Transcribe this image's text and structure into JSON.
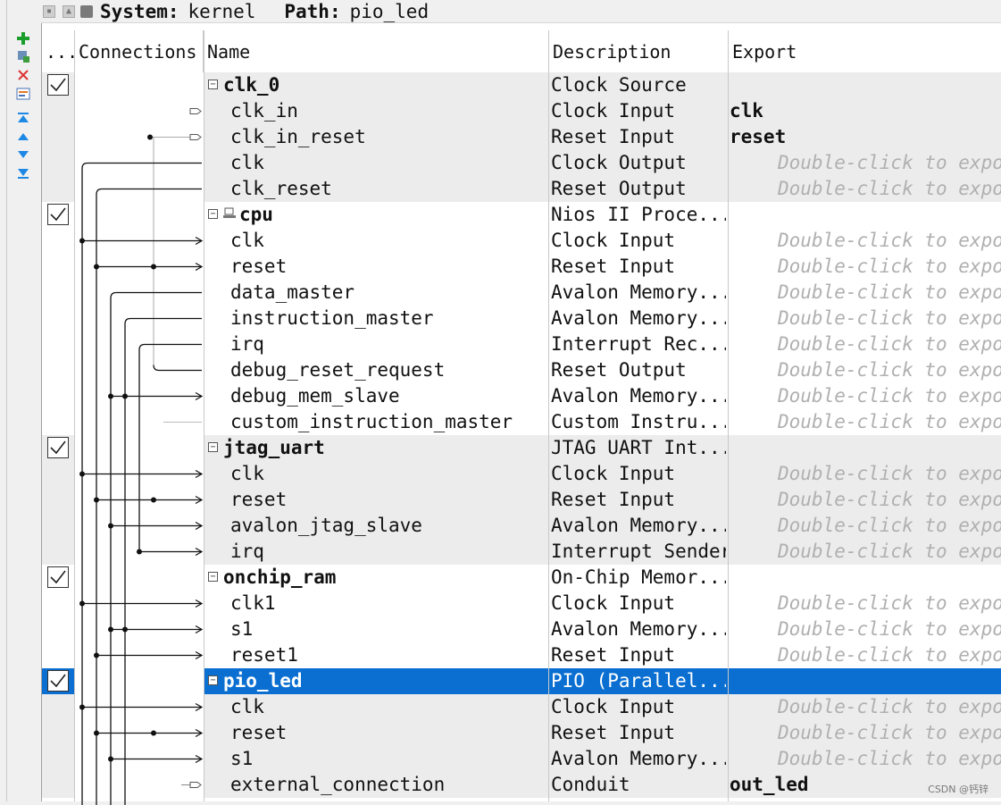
{
  "toolbar": {
    "add_icon": "plus-icon",
    "buttons": [
      "add-icon",
      "import-icon",
      "remove-icon",
      "edit-icon",
      "move-top-icon",
      "move-up-icon",
      "move-down-icon",
      "move-bottom-icon"
    ]
  },
  "topbar": {
    "system_label": "System:",
    "system_value": "kernel",
    "path_label": "Path:",
    "path_value": "pio_led"
  },
  "columns": {
    "use": "...",
    "connections": "Connections",
    "name": "Name",
    "description": "Description",
    "export": "Export"
  },
  "rows": [
    {
      "kind": "component",
      "name": "clk_0",
      "description": "Clock Source",
      "export": "",
      "checked": true
    },
    {
      "kind": "port",
      "name": "clk_in",
      "description": "Clock Input",
      "export": "clk",
      "export_style": "bold"
    },
    {
      "kind": "port",
      "name": "clk_in_reset",
      "description": "Reset Input",
      "export": "reset",
      "export_style": "bold"
    },
    {
      "kind": "port",
      "name": "clk",
      "description": "Clock Output",
      "export": "Double-click to expo",
      "export_style": "hint"
    },
    {
      "kind": "port",
      "name": "clk_reset",
      "description": "Reset Output",
      "export": "Double-click to expo",
      "export_style": "hint"
    },
    {
      "kind": "component",
      "name": "cpu",
      "description": "Nios II Proce...",
      "export": "",
      "checked": true,
      "has_icon": true
    },
    {
      "kind": "port",
      "name": "clk",
      "description": "Clock Input",
      "export": "Double-click to expo",
      "export_style": "hint"
    },
    {
      "kind": "port",
      "name": "reset",
      "description": "Reset Input",
      "export": "Double-click to expo",
      "export_style": "hint"
    },
    {
      "kind": "port",
      "name": "data_master",
      "description": "Avalon Memory...",
      "export": "Double-click to expo",
      "export_style": "hint"
    },
    {
      "kind": "port",
      "name": "instruction_master",
      "description": "Avalon Memory...",
      "export": "Double-click to expo",
      "export_style": "hint"
    },
    {
      "kind": "port",
      "name": "irq",
      "description": "Interrupt Rec...",
      "export": "Double-click to expo",
      "export_style": "hint"
    },
    {
      "kind": "port",
      "name": "debug_reset_request",
      "description": "Reset Output",
      "export": "Double-click to expo",
      "export_style": "hint"
    },
    {
      "kind": "port",
      "name": "debug_mem_slave",
      "description": "Avalon Memory...",
      "export": "Double-click to expo",
      "export_style": "hint"
    },
    {
      "kind": "port",
      "name": "custom_instruction_master",
      "description": "Custom Instru...",
      "export": "Double-click to expo",
      "export_style": "hint"
    },
    {
      "kind": "component",
      "name": "jtag_uart",
      "description": "JTAG UART Int...",
      "export": "",
      "checked": true
    },
    {
      "kind": "port",
      "name": "clk",
      "description": "Clock Input",
      "export": "Double-click to expo",
      "export_style": "hint"
    },
    {
      "kind": "port",
      "name": "reset",
      "description": "Reset Input",
      "export": "Double-click to expo",
      "export_style": "hint"
    },
    {
      "kind": "port",
      "name": "avalon_jtag_slave",
      "description": "Avalon Memory...",
      "export": "Double-click to expo",
      "export_style": "hint"
    },
    {
      "kind": "port",
      "name": "irq",
      "description": "Interrupt Sender",
      "export": "Double-click to expo",
      "export_style": "hint"
    },
    {
      "kind": "component",
      "name": "onchip_ram",
      "description": "On-Chip Memor...",
      "export": "",
      "checked": true
    },
    {
      "kind": "port",
      "name": "clk1",
      "description": "Clock Input",
      "export": "Double-click to expo",
      "export_style": "hint"
    },
    {
      "kind": "port",
      "name": "s1",
      "description": "Avalon Memory...",
      "export": "Double-click to expo",
      "export_style": "hint"
    },
    {
      "kind": "port",
      "name": "reset1",
      "description": "Reset Input",
      "export": "Double-click to expo",
      "export_style": "hint"
    },
    {
      "kind": "component",
      "name": "pio_led",
      "description": "PIO (Parallel...",
      "export": "",
      "checked": true,
      "selected": true
    },
    {
      "kind": "port",
      "name": "clk",
      "description": "Clock Input",
      "export": "Double-click to expo",
      "export_style": "hint"
    },
    {
      "kind": "port",
      "name": "reset",
      "description": "Reset Input",
      "export": "Double-click to expo",
      "export_style": "hint"
    },
    {
      "kind": "port",
      "name": "s1",
      "description": "Avalon Memory...",
      "export": "Double-click to expo",
      "export_style": "hint"
    },
    {
      "kind": "port",
      "name": "external_connection",
      "description": "Conduit",
      "export": "out_led",
      "export_style": "bold"
    }
  ],
  "watermark": "CSDN @钙锌"
}
